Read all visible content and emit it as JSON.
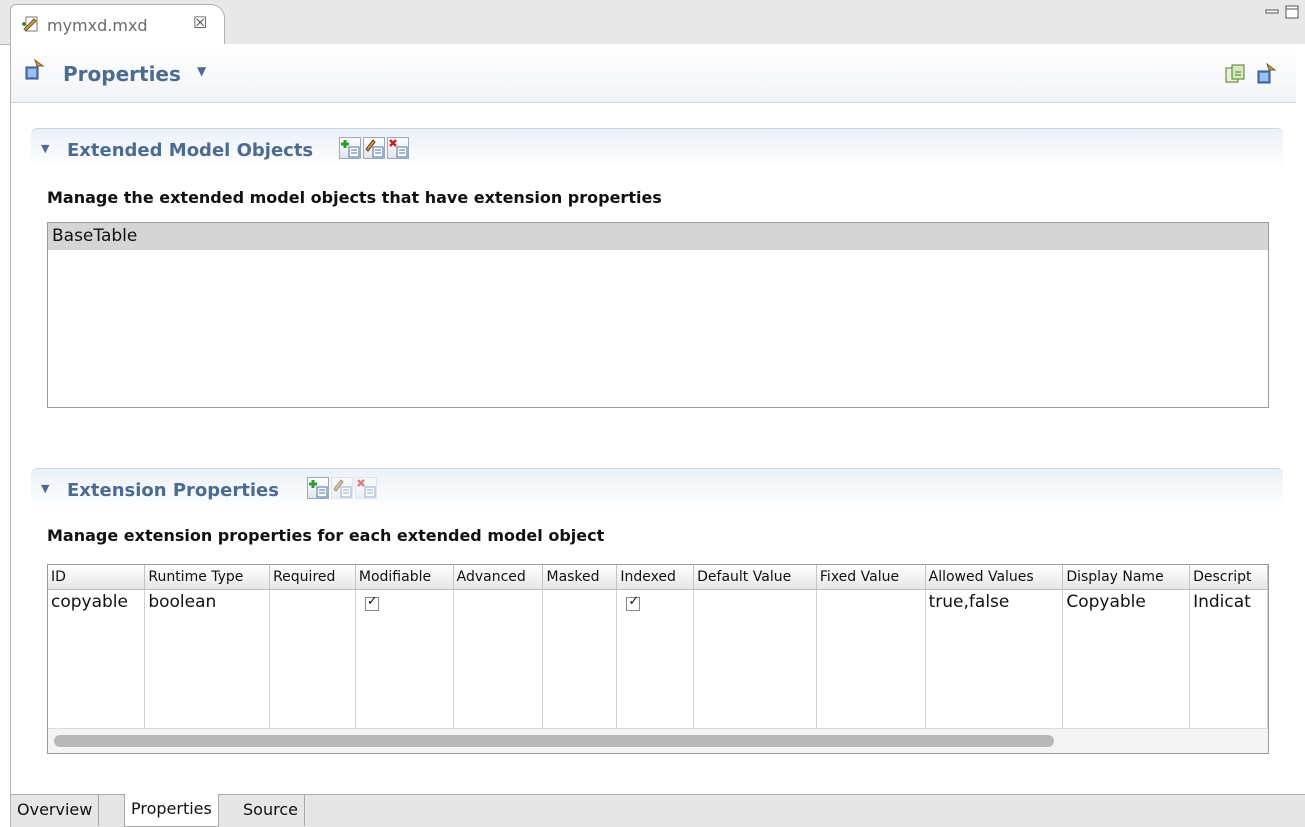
{
  "editor_tab": {
    "title": "mymxd.mxd",
    "close_glyph": "☒"
  },
  "window_buttons": [
    "minimize-icon",
    "maximize-icon"
  ],
  "form_header": {
    "title": "Properties",
    "caret": "▼",
    "tools": [
      "export-icon",
      "properties-icon"
    ],
    "title_color": "#4c6b8f"
  },
  "extended_model_objects": {
    "title": "Extended Model Objects",
    "twisty": "▼",
    "buttons": [
      {
        "name": "add-model-object-button",
        "icon": "add-icon",
        "enabled": true
      },
      {
        "name": "edit-model-object-button",
        "icon": "edit-icon",
        "enabled": true
      },
      {
        "name": "remove-model-object-button",
        "icon": "remove-icon",
        "enabled": true
      }
    ],
    "description": "Manage the extended model objects that have extension properties",
    "items": [
      "BaseTable"
    ]
  },
  "extension_properties": {
    "title": "Extension Properties",
    "twisty": "▼",
    "buttons": [
      {
        "name": "add-property-button",
        "icon": "add-icon",
        "enabled": true
      },
      {
        "name": "edit-property-button",
        "icon": "edit-icon",
        "enabled": false
      },
      {
        "name": "remove-property-button",
        "icon": "remove-icon",
        "enabled": false
      }
    ],
    "description": "Manage extension properties for each extended model object",
    "columns": [
      "ID",
      "Runtime Type",
      "Required",
      "Modifiable",
      "Advanced",
      "Masked",
      "Indexed",
      "Default Value",
      "Fixed Value",
      "Allowed Values",
      "Display Name",
      "Descript"
    ],
    "rows": [
      [
        "copyable",
        "boolean",
        "",
        "✓",
        "",
        "",
        "✓",
        "",
        "",
        "true,false",
        "Copyable",
        "Indicat"
      ]
    ]
  },
  "page_tabs": [
    {
      "label": "Overview",
      "active": false
    },
    {
      "label": "Properties",
      "active": true
    },
    {
      "label": "Source",
      "active": false
    }
  ]
}
